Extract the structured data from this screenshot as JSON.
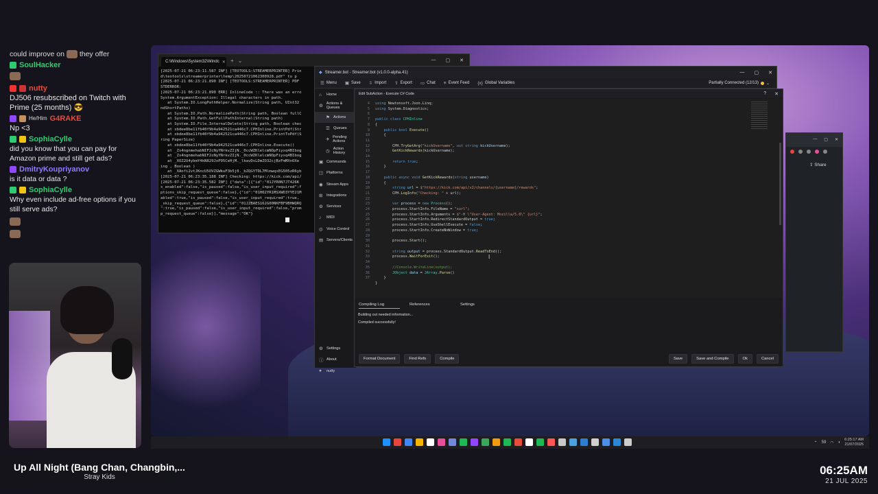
{
  "chat": {
    "top_partial": "could improve on",
    "top_partial_end": "they offer",
    "messages": [
      {
        "user": "SoulHacker",
        "user_color": "#2ecc71",
        "text": ""
      },
      {
        "user": "nutty",
        "user_color": "#e74c3c",
        "text": "DJ506 resubscribed on Twitch with Prime (25 months) 😎"
      },
      {
        "user": "G4RAKE",
        "user_color": "#e74c3c",
        "pronouns": "He/Him",
        "text": "Np <3"
      },
      {
        "user": "SophiaCylle",
        "user_color": "#2ecc71",
        "text": "did you know that you can pay for Amazon prime and still get ads?"
      },
      {
        "user": "DmitryKoupriyanov",
        "user_color": "#8e7cff",
        "text": "is it data or data ?"
      },
      {
        "user": "SophiaCylle",
        "user_color": "#2ecc71",
        "text": "Why even include ad-free options if you still serve ads?"
      }
    ]
  },
  "now_playing": {
    "title": "Up All Night (Bang Chan, Changbin,...",
    "artist": "Stray Kids"
  },
  "clock": {
    "time": "06:25AM",
    "date": "21 JUL 2025"
  },
  "terminal": {
    "tab_title": "C:\\Windows\\System32\\Windc",
    "lines": [
      "[2025-07-21 06:23:11.587 INF] [TEOTOOLS:STREAMERPRINTER] Prin",
      "d\\teotools\\streamerprinter\\temp\\20250721062300928.pdf\" to p",
      "[2025-07-21 06:23:21.890 INF] [TEOTOOLS:STREAMERPRINTER] PDF",
      "STDERROR:",
      "[2025-07-21 06:23:21.890 ERR] InlineCode :: There was an erro",
      "System.ArgumentException: Illegal characters in path.",
      "   at System.IO.LongPathHelper.Normalize(String path, UInt32",
      "ndShortPaths)",
      "   at System.IO.Path.NormalizePath(String path, Boolean fullC",
      "   at System.IO.Path.GetFullPathInternal(String path)",
      "   at System.IO.File.InternalDelete(String path, Boolean chec",
      "   at xbdee8be11fb40f9b4a942521ca446c7.CPHInline.PrintPdf(Str",
      "   at xbdee8be11fb40f9b4a942521ca446c7.CPHInline.PrintToPdf(S",
      "ring PaperSize)",
      "   at xbdee8be11fb40f9b4a942521ca446c7.CPHInline.Execute()",
      "   at _Zs4ngnmehabNIF2cNyYNrkvZIjN._0ccWZKlelcmNOpFiyxq4BIbog",
      "   at _Zs4ngnmehabNIF2cNyYNrkvZIjN._0ccWZKlelcmNOpFiyxq4BIbog",
      "   at _XOZ2U4ybmY4kN829JoP95CeHjM._lkavDsLDmZO32cjBzFmMXnOXe",
      "ing , Boolean )",
      "   at _XAnfi2vtJKncU5OVZGWkuF3b5j0._bZQGYTDL7MlmwqxEG505zR6yb",
      "[2025-07-21 06:23:35.188 INF] Checking: https://kick.com/api/",
      "[2025-07-21 06:23:35.582 INF] {\"data\":[{\"id\":\"01JYR0N7JT426K",
      "s_enabled\":false,\"is_paused\":false,\"is_user_input_required\":f",
      "ptions_skip_request_queue\":false},{\"id\":\"01H02YR1MSXWD3YYE21M",
      "abled\":true,\"is_paused\":false,\"is_user_input_required\":true,",
      "_skip_request_queue\":false},{\"id\":\"01JZBAES162G00NKFBF9BHWQRQ",
      "\":true,\"is_paused\":false,\"is_user_input_required\":false,\"prom",
      "p_request_queue\":false}],\"message\":\"OK\"}"
    ]
  },
  "streamerbot": {
    "title": "Streamer.bot - Streamer.bot (v1.0.0-alpha.41)",
    "toolbar": [
      {
        "icon": "☰",
        "label": "Menu"
      },
      {
        "icon": "▣",
        "label": "Save"
      },
      {
        "icon": "⇩",
        "label": "Import"
      },
      {
        "icon": "⇧",
        "label": "Export"
      },
      {
        "icon": "▭",
        "label": "Chat"
      },
      {
        "icon": "≡",
        "label": "Event Feed"
      },
      {
        "icon": "{x}",
        "label": "Global Variables"
      }
    ],
    "connection": "Partially Connected (12/13)",
    "sidebar": [
      {
        "icon": "⌂",
        "label": "Home",
        "sub": false
      },
      {
        "icon": "⚙",
        "label": "Actions & Queues",
        "sub": false
      },
      {
        "icon": "⚑",
        "label": "Actions",
        "sub": true,
        "active": true
      },
      {
        "icon": "☰",
        "label": "Queues",
        "sub": true
      },
      {
        "icon": "✈",
        "label": "Pending Actions",
        "sub": true
      },
      {
        "icon": "◷",
        "label": "Action History",
        "sub": true
      },
      {
        "icon": "▣",
        "label": "Commands",
        "sub": false
      },
      {
        "icon": "◫",
        "label": "Platforms",
        "sub": false
      },
      {
        "icon": "◉",
        "label": "Stream Apps",
        "sub": false
      },
      {
        "icon": "⊞",
        "label": "Integrations",
        "sub": false
      },
      {
        "icon": "⚙",
        "label": "Services",
        "sub": false
      },
      {
        "icon": "♪",
        "label": "MIDI",
        "sub": false
      },
      {
        "icon": "◎",
        "label": "Voice Control",
        "sub": false
      },
      {
        "icon": "▤",
        "label": "Servers/Clients",
        "sub": false
      }
    ],
    "sidebar_bottom": [
      {
        "icon": "⚙",
        "label": "Settings"
      },
      {
        "icon": "ⓘ",
        "label": "About"
      },
      {
        "icon": "●",
        "label": "nutty"
      }
    ]
  },
  "dialog": {
    "title": "Edit SubAction - Execute C# Code",
    "line_numbers": [
      "4",
      "5",
      "6",
      "7",
      "8",
      "9",
      "10",
      "11",
      "12",
      "13",
      "14",
      "15",
      "16",
      "17",
      "18",
      "19",
      "20",
      "21",
      "22",
      "23",
      "24",
      "25",
      "26",
      "27",
      "28",
      "29",
      "30",
      "31",
      "32",
      "33",
      "34",
      "35",
      "36",
      "37"
    ],
    "tabs": [
      "Compiling Log",
      "References",
      "Settings"
    ],
    "log_lines": [
      "Building out needed information...",
      "Compiled successfully!"
    ],
    "footer_left": [
      "Format Document",
      "Find Refs",
      "Compile"
    ],
    "footer_right": [
      "Save",
      "Save and Compile",
      "Ok",
      "Cancel"
    ]
  },
  "taskbar": {
    "icon_colors": [
      "#1e90ff",
      "#e8453c",
      "#4285f4",
      "#f5b400",
      "#ffffff",
      "#e94e9a",
      "#7289da",
      "#1db954",
      "#9146ff",
      "#3ba55c",
      "#f39c12",
      "#1db954",
      "#e74c3c",
      "#ffffff",
      "#1db954",
      "#ff5555",
      "#c9c9c9",
      "#4aa3df",
      "#2d7dd2",
      "#cfcfcf",
      "#4d8fe8",
      "#2b88d8",
      "#cccccc"
    ],
    "tray_text": "59",
    "time": "6:25:17 AM",
    "date": "21/07/2025"
  },
  "browser": {
    "share_label": "Share"
  }
}
